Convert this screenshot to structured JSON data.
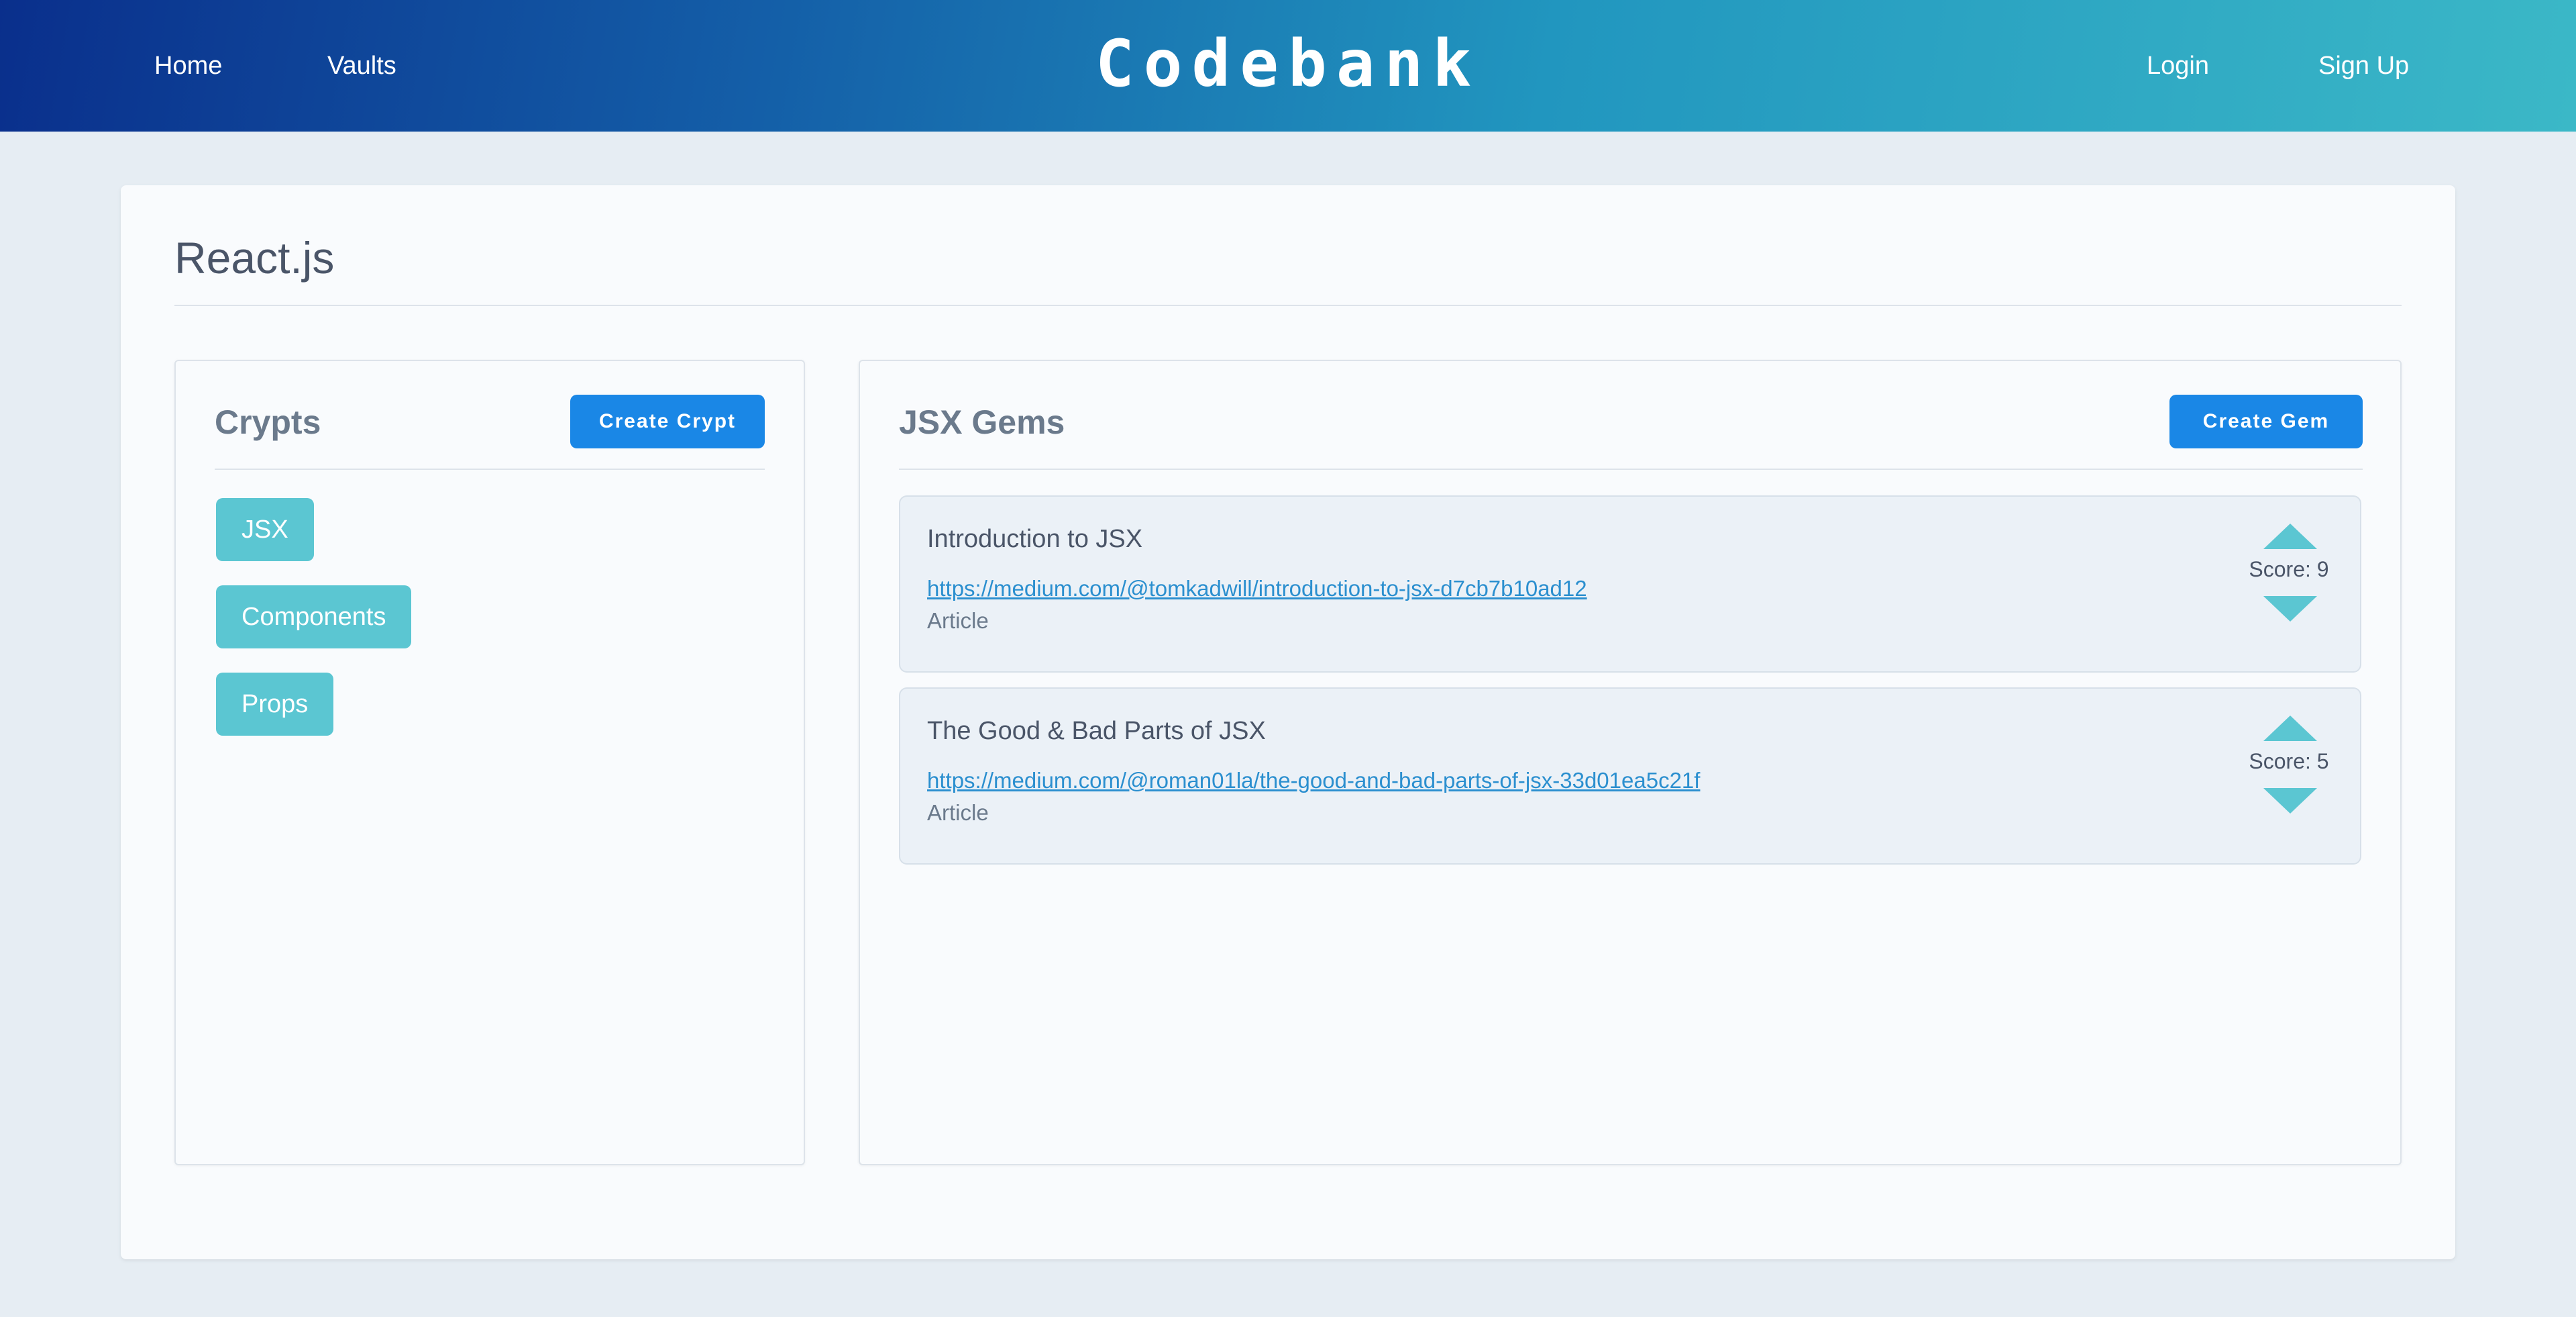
{
  "nav": {
    "home": "Home",
    "vaults": "Vaults",
    "brand": "Codebank",
    "login": "Login",
    "signup": "Sign Up"
  },
  "vault": {
    "title": "React.js"
  },
  "crypts": {
    "title": "Crypts",
    "create_label": "Create Crypt",
    "items": [
      {
        "label": "JSX"
      },
      {
        "label": "Components"
      },
      {
        "label": "Props"
      }
    ]
  },
  "gems": {
    "title": "JSX Gems",
    "create_label": "Create Gem",
    "items": [
      {
        "title": "Introduction to JSX",
        "url": "https://medium.com/@tomkadwill/introduction-to-jsx-d7cb7b10ad12",
        "type": "Article",
        "score": "Score: 9"
      },
      {
        "title": "The Good & Bad Parts of JSX",
        "url": "https://medium.com/@roman01la/the-good-and-bad-parts-of-jsx-33d01ea5c21f",
        "type": "Article",
        "score": "Score: 5"
      }
    ]
  },
  "colors": {
    "accent_button": "#1a87e6",
    "crypt_chip": "#5bc6d2",
    "link": "#2b8fcf"
  },
  "icons": {
    "upvote": "triangle-up-icon",
    "downvote": "triangle-down-icon"
  }
}
